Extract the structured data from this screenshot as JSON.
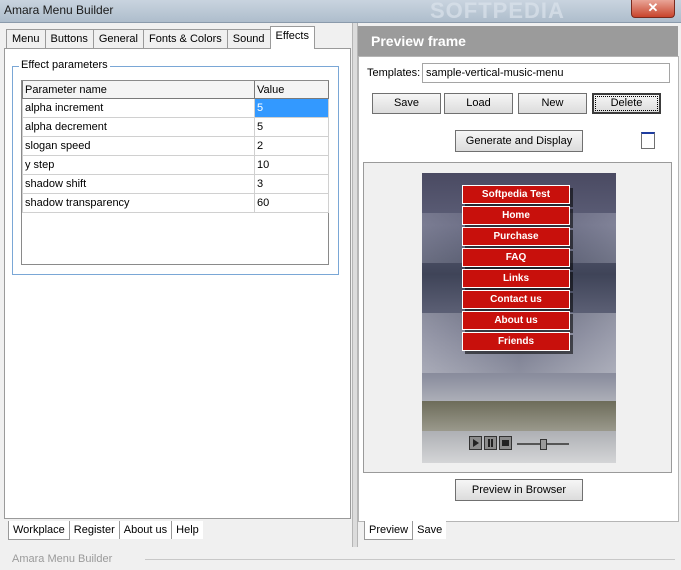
{
  "window": {
    "title": "Amara Menu Builder",
    "watermark": "SOFTPEDIA",
    "close_glyph": "✕"
  },
  "left_tabs": [
    "Menu",
    "Buttons",
    "General",
    "Fonts & Colors",
    "Sound",
    "Effects"
  ],
  "left_active_tab": "Effects",
  "effects": {
    "group_label": "Effect parameters",
    "columns": [
      "Parameter name",
      "Value"
    ],
    "rows": [
      {
        "name": "alpha increment",
        "value": "5"
      },
      {
        "name": "alpha decrement",
        "value": "5"
      },
      {
        "name": "slogan speed",
        "value": "2"
      },
      {
        "name": "y step",
        "value": "10"
      },
      {
        "name": "shadow shift",
        "value": "3"
      },
      {
        "name": "shadow transparency",
        "value": "60"
      }
    ]
  },
  "left_bottom_tabs": [
    "Workplace",
    "Register",
    "About us",
    "Help"
  ],
  "preview": {
    "header": "Preview frame",
    "templates_label": "Templates:",
    "templates_value": "sample-vertical-music-menu",
    "buttons": {
      "save": "Save",
      "load": "Load",
      "new": "New",
      "delete": "Delete"
    },
    "generate_label": "Generate and Display",
    "browser_label": "Preview in Browser",
    "menu_items": [
      "Softpedia Test",
      "Home",
      "Purchase",
      "FAQ",
      "Links",
      "Contact us",
      "About us",
      "Friends"
    ]
  },
  "right_bottom_tabs": [
    "Preview",
    "Save"
  ],
  "status": {
    "text": "Amara Menu Builder"
  },
  "colors": {
    "menu_red": "#c8100c",
    "selection": "#3399ff",
    "header_gray": "#9b9b9b"
  }
}
